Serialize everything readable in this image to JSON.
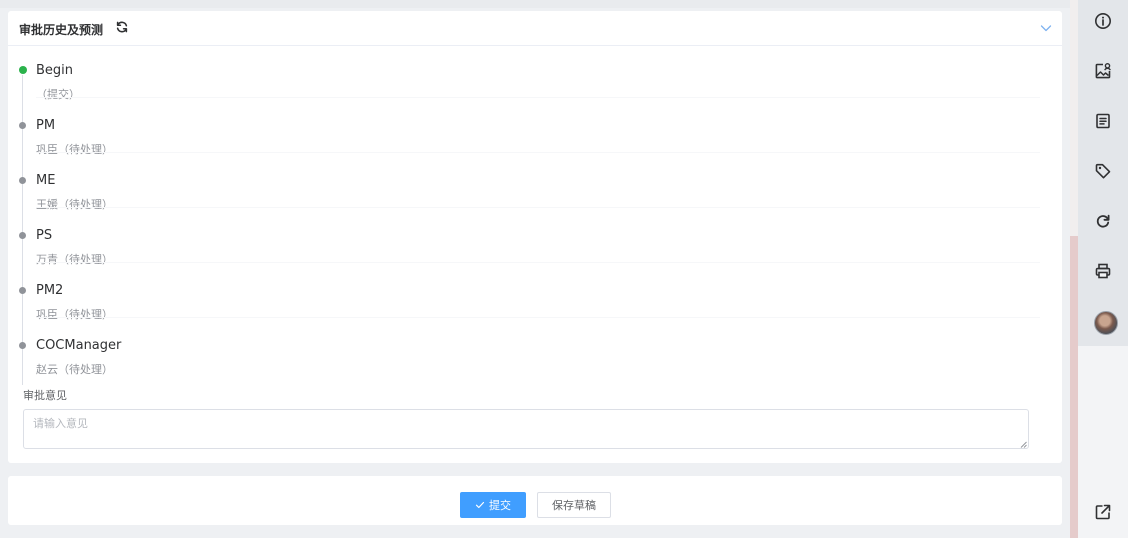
{
  "panel": {
    "title": "审批历史及预测",
    "icons": {
      "refresh": "refresh-icon",
      "collapse": "chevron-down-icon"
    }
  },
  "timeline": {
    "items": [
      {
        "name": "Begin",
        "sub": "（提交）",
        "status": "done",
        "color": "#2bb24c"
      },
      {
        "name": "PM",
        "sub": "巩臣（待处理）",
        "status": "pending",
        "color": "#909399"
      },
      {
        "name": "ME",
        "sub": "王媛（待处理）",
        "status": "pending",
        "color": "#909399"
      },
      {
        "name": "PS",
        "sub": "万青（待处理）",
        "status": "pending",
        "color": "#909399"
      },
      {
        "name": "PM2",
        "sub": "巩臣（待处理）",
        "status": "pending",
        "color": "#909399"
      },
      {
        "name": "COCManager",
        "sub": "赵云（待处理）",
        "status": "pending",
        "color": "#909399"
      }
    ]
  },
  "opinion": {
    "label": "审批意见",
    "placeholder": "请输入意见",
    "value": ""
  },
  "footer": {
    "submit_label": "提交",
    "draft_label": "保存草稿",
    "submit_icon": "check-icon"
  },
  "sidebar": {
    "icons": [
      "info-icon",
      "image-user-icon",
      "document-icon",
      "tag-icon",
      "refresh-icon",
      "printer-icon",
      "avatar",
      "external-link-icon"
    ]
  },
  "colors": {
    "accent": "#409eff",
    "success": "#2bb24c",
    "pending": "#909399"
  }
}
